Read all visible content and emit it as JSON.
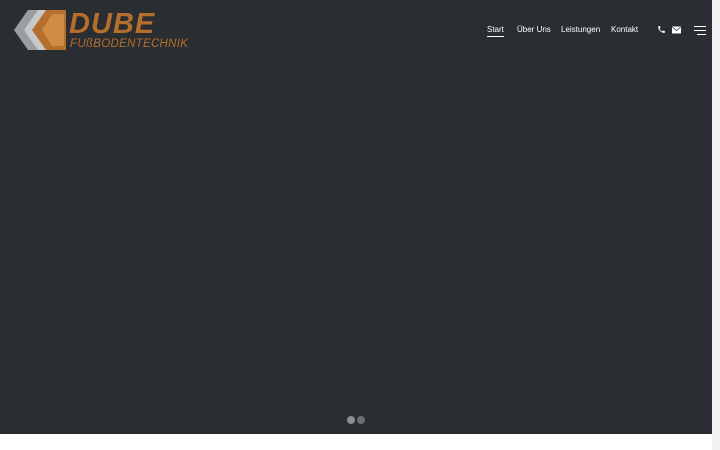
{
  "brand": {
    "name": "DUBE",
    "tagline": "FUßBODENTECHNIK",
    "color": "#b56f2c"
  },
  "nav": {
    "items": [
      {
        "label": "Start",
        "active": true
      },
      {
        "label": "Über Uns",
        "active": false
      },
      {
        "label": "Leistungen",
        "active": false
      },
      {
        "label": "Kontakt",
        "active": false
      }
    ]
  },
  "header_icons": [
    "phone-icon",
    "mail-icon",
    "menu-icon"
  ],
  "hero": {
    "background": "#2a2d31",
    "slides": 2,
    "active_slide": 1
  }
}
